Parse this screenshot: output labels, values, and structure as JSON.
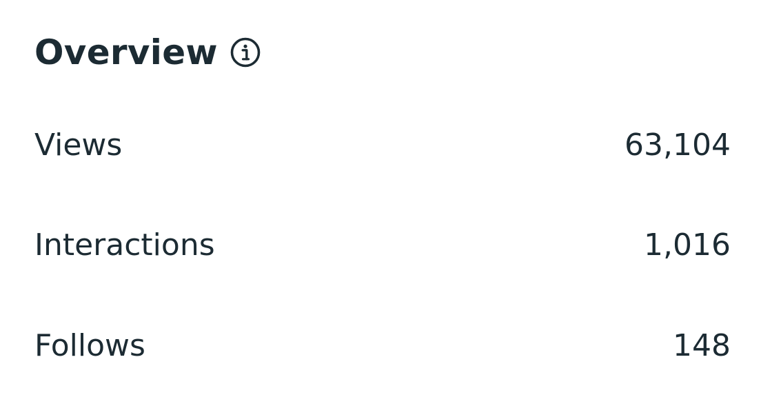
{
  "overview": {
    "title": "Overview",
    "info_icon": "info-circle-icon",
    "metrics": [
      {
        "label": "Views",
        "value": "63,104"
      },
      {
        "label": "Interactions",
        "value": "1,016"
      },
      {
        "label": "Follows",
        "value": "148"
      }
    ]
  },
  "colors": {
    "text": "#1c2b33",
    "icon": "#1c2b33",
    "background": "#ffffff"
  }
}
